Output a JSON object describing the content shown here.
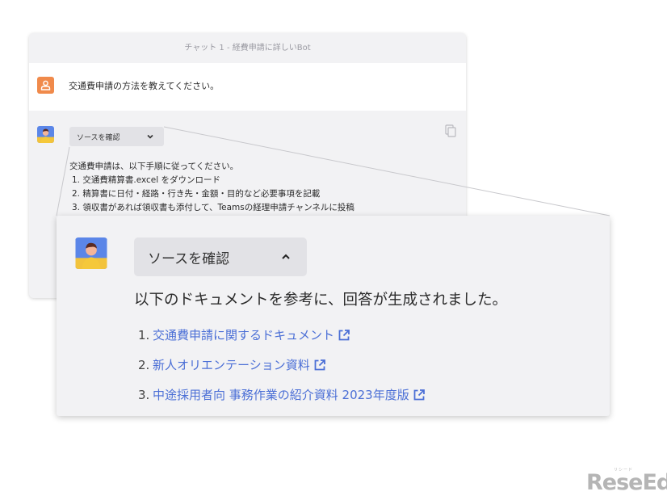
{
  "chat": {
    "title": "チャット 1 - 経費申請に詳しいBot",
    "user_message": "交通費申請の方法を教えてください。",
    "source_button_label": "ソースを確認",
    "answer_intro": "交通費申請は、以下手順に従ってください。",
    "answer_steps": [
      "1. 交通費精算書.excel をダウンロード",
      "2. 精算書に日付・経路・行き先・金額・目的など必要事項を記載",
      "3. 領収書があれば領収書も添付して、Teamsの経理申請チャンネルに投稿"
    ]
  },
  "zoom": {
    "source_button_label": "ソースを確認",
    "lead_text": "以下のドキュメントを参考に、回答が生成されました。",
    "documents": [
      {
        "num": "1.",
        "title": "交通費申請に関するドキュメント"
      },
      {
        "num": "2.",
        "title": "新人オリエンテーション資料"
      },
      {
        "num": "3.",
        "title": "中途採用者向 事務作業の紹介資料 2023年度版"
      }
    ]
  },
  "colors": {
    "accent_link": "#4b6fd6",
    "user_avatar": "#f08a4b",
    "panel_bg": "#f2f2f4",
    "button_bg": "#e2e2e6"
  },
  "icons": [
    "user-icon",
    "bot-avatar",
    "chevron-down-icon",
    "chevron-up-icon",
    "copy-icon",
    "external-link-icon"
  ],
  "watermark": {
    "text": "ReseEd",
    "ruby": "リシード"
  }
}
